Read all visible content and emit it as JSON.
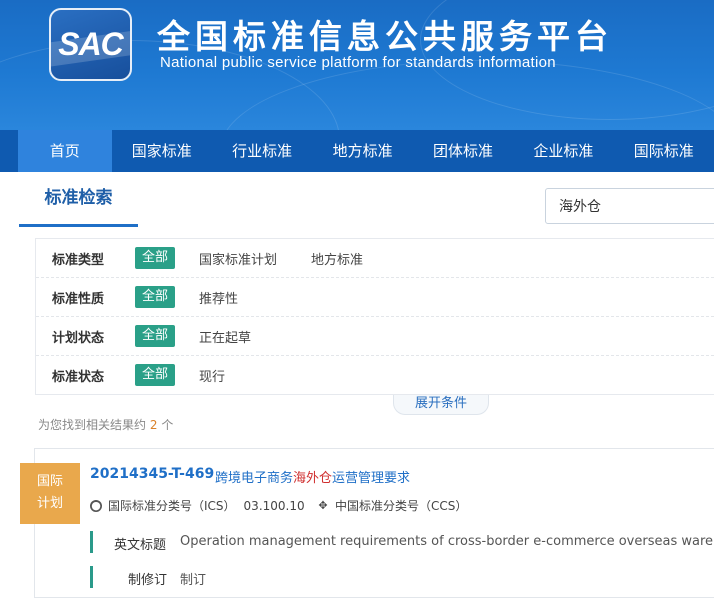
{
  "header": {
    "logo_text": "SAC",
    "title": "全国标准信息公共服务平台",
    "subtitle": "National public service platform  for standards information"
  },
  "nav": {
    "items": [
      "首页",
      "国家标准",
      "行业标准",
      "地方标准",
      "团体标准",
      "企业标准",
      "国际标准"
    ],
    "active_index": 0
  },
  "search": {
    "tab_label": "标准检索",
    "query": "海外仓"
  },
  "filters": [
    {
      "label": "标准类型",
      "all": "全部",
      "options": [
        "国家标准计划",
        "地方标准"
      ]
    },
    {
      "label": "标准性质",
      "all": "全部",
      "options": [
        "推荐性"
      ]
    },
    {
      "label": "计划状态",
      "all": "全部",
      "options": [
        "正在起草"
      ]
    },
    {
      "label": "标准状态",
      "all": "全部",
      "options": [
        "现行"
      ]
    }
  ],
  "expand_label": "展开条件",
  "results": {
    "summary_prefix": "为您找到相关结果约",
    "count": "2",
    "summary_suffix": "个"
  },
  "result_item": {
    "badge_line1": "国际",
    "badge_line2": "计划",
    "number": "20214345-T-469",
    "name_before": "跨境电子商务",
    "name_highlight": "海外仓",
    "name_after": "运营管理要求",
    "ics_label": "国际标准分类号（ICS）",
    "ics_value": "03.100.10",
    "ccs_label": "中国标准分类号（CCS）",
    "ccs_value": "",
    "english_title_label": "英文标题",
    "english_title_value": "Operation management requirements of cross-border e-commerce overseas warehouse",
    "revision_label": "制修订",
    "revision_value": "制订"
  },
  "colors": {
    "banner": "#1e79d2",
    "nav": "#0f5ab0",
    "nav_active": "#2f83dd",
    "accent_green": "#2aa088",
    "badge_orange": "#e9a84c",
    "link_blue": "#1f6fc7",
    "highlight_red": "#d03030"
  },
  "icons": {
    "globe": "globe-icon",
    "ccs": "crosshair-icon"
  }
}
